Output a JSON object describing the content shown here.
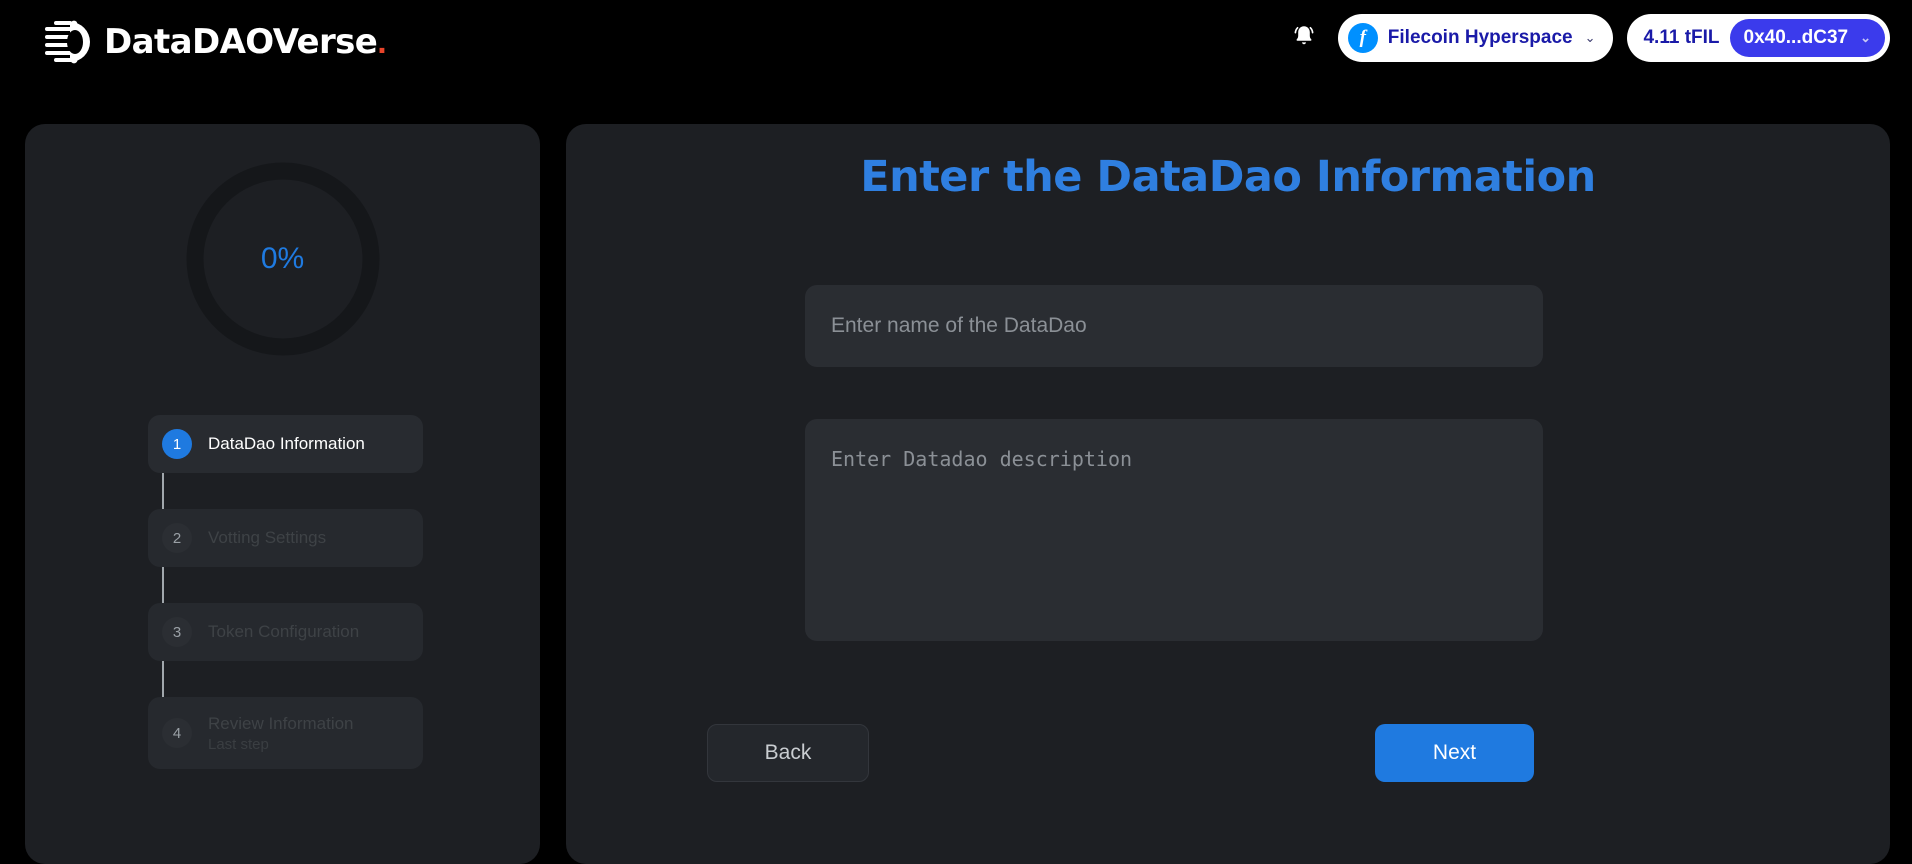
{
  "brand": {
    "name": "DataDAOVerse",
    "dot": ".",
    "logo_icon": "datadaoverse-circuit-d-icon",
    "dot_color": "#e8442a"
  },
  "topbar": {
    "notification_icon": "bell-icon",
    "network": {
      "icon": "filecoin-icon",
      "glyph": "f",
      "label": "Filecoin Hyperspace",
      "chevron": "chevron-down-icon",
      "chevron_glyph": "⌄"
    },
    "wallet": {
      "balance": "4.11 tFIL",
      "address": "0x40...dC37",
      "chevron": "chevron-down-icon",
      "chevron_glyph": "⌄",
      "pill_color": "#3b3bec"
    }
  },
  "sidebar": {
    "progress": {
      "value": "0%",
      "percent": 0,
      "track_color": "#15171a",
      "text_color": "#1f7ae0"
    },
    "steps": [
      {
        "number": "1",
        "label": "DataDao Information",
        "sub": "",
        "active": true
      },
      {
        "number": "2",
        "label": "Votting Settings",
        "sub": "",
        "active": false
      },
      {
        "number": "3",
        "label": "Token Configuration",
        "sub": "",
        "active": false
      },
      {
        "number": "4",
        "label": "Review Information",
        "sub": "Last step",
        "active": false
      }
    ]
  },
  "main": {
    "title": "Enter the DataDao Information",
    "title_color": "#2f7fe0",
    "name_field": {
      "value": "",
      "placeholder": "Enter name of the DataDao"
    },
    "description_field": {
      "value": "",
      "placeholder": "Enter Datadao description"
    },
    "back_label": "Back",
    "next_label": "Next",
    "next_color": "#1f7ae0"
  }
}
